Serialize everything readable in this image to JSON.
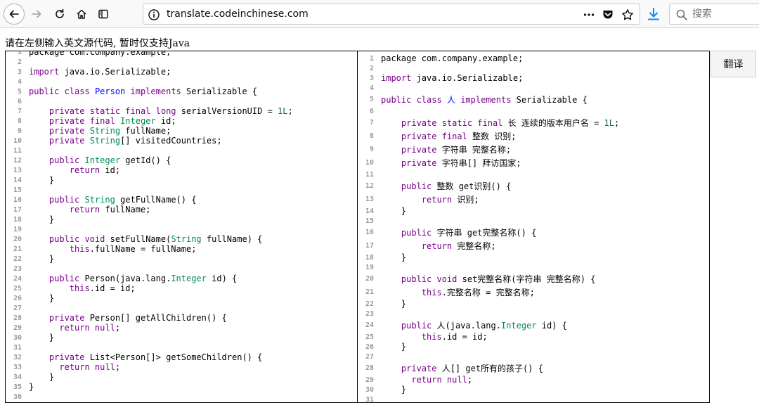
{
  "browser": {
    "url": "translate.codeinchinese.com",
    "search_placeholder": "搜索",
    "accent_color": "#0a84ff"
  },
  "page": {
    "instruction": "请在左侧输入英文源代码, 暂时仅支持Java",
    "translate_button": "翻译"
  },
  "source_code": [
    {
      "n": "1",
      "tokens": [
        [
          "package com.company.example;",
          ""
        ]
      ]
    },
    {
      "n": "2",
      "tokens": []
    },
    {
      "n": "3",
      "tokens": [
        [
          "import",
          "kw"
        ],
        [
          " java.io.Serializable;",
          ""
        ]
      ]
    },
    {
      "n": "4",
      "tokens": []
    },
    {
      "n": "5",
      "tokens": [
        [
          "public class",
          "kw"
        ],
        [
          " ",
          ""
        ],
        [
          "Person",
          "cls"
        ],
        [
          " ",
          ""
        ],
        [
          "implements",
          "kw"
        ],
        [
          " Serializable {",
          ""
        ]
      ]
    },
    {
      "n": "6",
      "tokens": []
    },
    {
      "n": "7",
      "tokens": [
        [
          "    ",
          ""
        ],
        [
          "private static final long",
          "kw"
        ],
        [
          " serialVersionUID = ",
          ""
        ],
        [
          "1L",
          "num"
        ],
        [
          ";",
          ""
        ]
      ]
    },
    {
      "n": "8",
      "tokens": [
        [
          "    ",
          ""
        ],
        [
          "private final",
          "kw"
        ],
        [
          " ",
          ""
        ],
        [
          "Integer",
          "ty"
        ],
        [
          " id;",
          ""
        ]
      ]
    },
    {
      "n": "9",
      "tokens": [
        [
          "    ",
          ""
        ],
        [
          "private",
          "kw"
        ],
        [
          " ",
          ""
        ],
        [
          "String",
          "ty"
        ],
        [
          " fullName;",
          ""
        ]
      ]
    },
    {
      "n": "10",
      "tokens": [
        [
          "    ",
          ""
        ],
        [
          "private",
          "kw"
        ],
        [
          " ",
          ""
        ],
        [
          "String",
          "ty"
        ],
        [
          "[] visitedCountries;",
          ""
        ]
      ]
    },
    {
      "n": "11",
      "tokens": []
    },
    {
      "n": "12",
      "tokens": [
        [
          "    ",
          ""
        ],
        [
          "public",
          "kw"
        ],
        [
          " ",
          ""
        ],
        [
          "Integer",
          "ty"
        ],
        [
          " getId() {",
          ""
        ]
      ]
    },
    {
      "n": "13",
      "tokens": [
        [
          "        ",
          ""
        ],
        [
          "return",
          "kw"
        ],
        [
          " id;",
          ""
        ]
      ]
    },
    {
      "n": "14",
      "tokens": [
        [
          "    }",
          ""
        ]
      ]
    },
    {
      "n": "15",
      "tokens": []
    },
    {
      "n": "16",
      "tokens": [
        [
          "    ",
          ""
        ],
        [
          "public",
          "kw"
        ],
        [
          " ",
          ""
        ],
        [
          "String",
          "ty"
        ],
        [
          " getFullName() {",
          ""
        ]
      ]
    },
    {
      "n": "17",
      "tokens": [
        [
          "        ",
          ""
        ],
        [
          "return",
          "kw"
        ],
        [
          " fullName;",
          ""
        ]
      ]
    },
    {
      "n": "18",
      "tokens": [
        [
          "    }",
          ""
        ]
      ]
    },
    {
      "n": "19",
      "tokens": []
    },
    {
      "n": "20",
      "tokens": [
        [
          "    ",
          ""
        ],
        [
          "public void",
          "kw"
        ],
        [
          " setFullName(",
          ""
        ],
        [
          "String",
          "ty"
        ],
        [
          " fullName) {",
          ""
        ]
      ]
    },
    {
      "n": "21",
      "tokens": [
        [
          "        ",
          ""
        ],
        [
          "this",
          "kw"
        ],
        [
          ".fullName = fullName;",
          ""
        ]
      ]
    },
    {
      "n": "22",
      "tokens": [
        [
          "    }",
          ""
        ]
      ]
    },
    {
      "n": "23",
      "tokens": []
    },
    {
      "n": "24",
      "tokens": [
        [
          "    ",
          ""
        ],
        [
          "public",
          "kw"
        ],
        [
          " Person(java.lang.",
          ""
        ],
        [
          "Integer",
          "ty"
        ],
        [
          " id) {",
          ""
        ]
      ]
    },
    {
      "n": "25",
      "tokens": [
        [
          "        ",
          ""
        ],
        [
          "this",
          "kw"
        ],
        [
          ".id = id;",
          ""
        ]
      ]
    },
    {
      "n": "26",
      "tokens": [
        [
          "    }",
          ""
        ]
      ]
    },
    {
      "n": "27",
      "tokens": []
    },
    {
      "n": "28",
      "tokens": [
        [
          "    ",
          ""
        ],
        [
          "private",
          "kw"
        ],
        [
          " Person[] getAllChildren() {",
          ""
        ]
      ]
    },
    {
      "n": "29",
      "tokens": [
        [
          "      ",
          ""
        ],
        [
          "return null",
          "kw"
        ],
        [
          ";",
          ""
        ]
      ]
    },
    {
      "n": "30",
      "tokens": [
        [
          "    }",
          ""
        ]
      ]
    },
    {
      "n": "31",
      "tokens": []
    },
    {
      "n": "32",
      "tokens": [
        [
          "    ",
          ""
        ],
        [
          "private",
          "kw"
        ],
        [
          " List<Person[]> getSomeChildren() {",
          ""
        ]
      ]
    },
    {
      "n": "33",
      "tokens": [
        [
          "      ",
          ""
        ],
        [
          "return null",
          "kw"
        ],
        [
          ";",
          ""
        ]
      ]
    },
    {
      "n": "34",
      "tokens": [
        [
          "    }",
          ""
        ]
      ]
    },
    {
      "n": "35",
      "tokens": [
        [
          "}",
          ""
        ]
      ]
    },
    {
      "n": "36",
      "tokens": []
    }
  ],
  "translated_code": [
    {
      "n": "1",
      "tokens": [
        [
          "package com.company.example;",
          ""
        ]
      ]
    },
    {
      "n": "2",
      "tokens": []
    },
    {
      "n": "3",
      "tokens": [
        [
          "import",
          "kw"
        ],
        [
          " java.io.Serializable;",
          ""
        ]
      ]
    },
    {
      "n": "4",
      "tokens": []
    },
    {
      "n": "5",
      "tall": true,
      "tokens": [
        [
          "public class",
          "kw"
        ],
        [
          " ",
          ""
        ],
        [
          "人",
          "cls"
        ],
        [
          " ",
          ""
        ],
        [
          "implements",
          "kw"
        ],
        [
          " Serializable {",
          ""
        ]
      ]
    },
    {
      "n": "6",
      "tokens": []
    },
    {
      "n": "7",
      "tall": true,
      "tokens": [
        [
          "    ",
          ""
        ],
        [
          "private static final",
          "kw"
        ],
        [
          " 长 连续的版本用户名 = ",
          ""
        ],
        [
          "1L",
          "num"
        ],
        [
          ";",
          ""
        ]
      ]
    },
    {
      "n": "8",
      "tall": true,
      "tokens": [
        [
          "    ",
          ""
        ],
        [
          "private final",
          "kw"
        ],
        [
          " 整数 识别;",
          ""
        ]
      ]
    },
    {
      "n": "9",
      "tall": true,
      "tokens": [
        [
          "    ",
          ""
        ],
        [
          "private",
          "kw"
        ],
        [
          " 字符串 完整名称;",
          ""
        ]
      ]
    },
    {
      "n": "10",
      "tall": true,
      "tokens": [
        [
          "    ",
          ""
        ],
        [
          "private",
          "kw"
        ],
        [
          " 字符串[] 拜访国家;",
          ""
        ]
      ]
    },
    {
      "n": "11",
      "tokens": []
    },
    {
      "n": "12",
      "tall": true,
      "tokens": [
        [
          "    ",
          ""
        ],
        [
          "public",
          "kw"
        ],
        [
          " 整数 get识别() {",
          ""
        ]
      ]
    },
    {
      "n": "13",
      "tall": true,
      "tokens": [
        [
          "        ",
          ""
        ],
        [
          "return",
          "kw"
        ],
        [
          " 识别;",
          ""
        ]
      ]
    },
    {
      "n": "14",
      "tokens": [
        [
          "    }",
          ""
        ]
      ]
    },
    {
      "n": "15",
      "tokens": []
    },
    {
      "n": "16",
      "tall": true,
      "tokens": [
        [
          "    ",
          ""
        ],
        [
          "public",
          "kw"
        ],
        [
          " 字符串 get完整名称() {",
          ""
        ]
      ]
    },
    {
      "n": "17",
      "tall": true,
      "tokens": [
        [
          "        ",
          ""
        ],
        [
          "return",
          "kw"
        ],
        [
          " 完整名称;",
          ""
        ]
      ]
    },
    {
      "n": "18",
      "tokens": [
        [
          "    }",
          ""
        ]
      ]
    },
    {
      "n": "19",
      "tokens": []
    },
    {
      "n": "20",
      "tall": true,
      "tokens": [
        [
          "    ",
          ""
        ],
        [
          "public void",
          "kw"
        ],
        [
          " set完整名称(字符串 完整名称) {",
          ""
        ]
      ]
    },
    {
      "n": "21",
      "tall": true,
      "tokens": [
        [
          "        ",
          ""
        ],
        [
          "this",
          "kw"
        ],
        [
          ".完整名称 = 完整名称;",
          ""
        ]
      ]
    },
    {
      "n": "22",
      "tokens": [
        [
          "    }",
          ""
        ]
      ]
    },
    {
      "n": "23",
      "tokens": []
    },
    {
      "n": "24",
      "tall": true,
      "tokens": [
        [
          "    ",
          ""
        ],
        [
          "public",
          "kw"
        ],
        [
          " 人(java.lang.",
          ""
        ],
        [
          "Integer",
          "ty"
        ],
        [
          " id) {",
          ""
        ]
      ]
    },
    {
      "n": "25",
      "tokens": [
        [
          "        ",
          ""
        ],
        [
          "this",
          "kw"
        ],
        [
          ".id = id;",
          ""
        ]
      ]
    },
    {
      "n": "26",
      "tokens": [
        [
          "    }",
          ""
        ]
      ]
    },
    {
      "n": "27",
      "tokens": []
    },
    {
      "n": "28",
      "tall": true,
      "tokens": [
        [
          "    ",
          ""
        ],
        [
          "private",
          "kw"
        ],
        [
          " 人[] get所有的孩子() {",
          ""
        ]
      ]
    },
    {
      "n": "29",
      "tokens": [
        [
          "      ",
          ""
        ],
        [
          "return null",
          "kw"
        ],
        [
          ";",
          ""
        ]
      ]
    },
    {
      "n": "30",
      "tokens": [
        [
          "    }",
          ""
        ]
      ]
    },
    {
      "n": "31",
      "tokens": []
    }
  ]
}
